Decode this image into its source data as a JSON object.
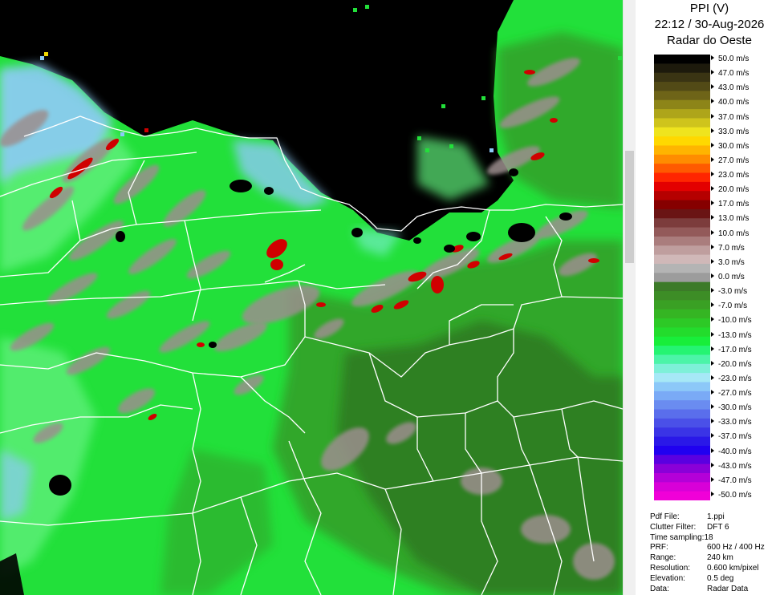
{
  "header": {
    "product": "PPI (V)",
    "datetime": "22:12 / 30-Aug-2026",
    "station": "Radar do Oeste"
  },
  "scale": {
    "labels": [
      "50.0 m/s",
      "47.0 m/s",
      "43.0 m/s",
      "40.0 m/s",
      "37.0 m/s",
      "33.0 m/s",
      "30.0 m/s",
      "27.0 m/s",
      "23.0 m/s",
      "20.0 m/s",
      "17.0 m/s",
      "13.0 m/s",
      "10.0 m/s",
      "7.0 m/s",
      "3.0 m/s",
      "0.0 m/s",
      "-3.0 m/s",
      "-7.0 m/s",
      "-10.0 m/s",
      "-13.0 m/s",
      "-17.0 m/s",
      "-20.0 m/s",
      "-23.0 m/s",
      "-27.0 m/s",
      "-30.0 m/s",
      "-33.0 m/s",
      "-37.0 m/s",
      "-40.0 m/s",
      "-43.0 m/s",
      "-47.0 m/s",
      "-50.0 m/s"
    ],
    "colors": [
      "#000000",
      "#1d1a0c",
      "#3a3413",
      "#524a16",
      "#6e6418",
      "#8d8518",
      "#aea51a",
      "#cfc41c",
      "#efe41e",
      "#ffd800",
      "#ffb400",
      "#ff8c00",
      "#ff5a00",
      "#ff2600",
      "#e30000",
      "#b50000",
      "#860000",
      "#6a1414",
      "#7c3c3c",
      "#935a5a",
      "#aa7d7d",
      "#bf9e9e",
      "#d0b8b8",
      "#b4b4b4",
      "#9c9c9c",
      "#3c7a28",
      "#3d8d26",
      "#3aa024",
      "#35b523",
      "#2dc926",
      "#23dc2c",
      "#18ee3a",
      "#25f472",
      "#4cf4a8",
      "#7ef0d8",
      "#a6e8f6",
      "#8cc8f8",
      "#7aaaf6",
      "#6a8cf0",
      "#5a6eec",
      "#4a50e8",
      "#3a34e6",
      "#2a18e8",
      "#2000f0",
      "#5a00e0",
      "#8a00d8",
      "#b400d8",
      "#d800d8",
      "#f000d8"
    ]
  },
  "info": [
    {
      "key": "Pdf File:",
      "value": "1.ppi"
    },
    {
      "key": "Clutter Filter:",
      "value": "DFT 6"
    },
    {
      "key": "Time sampling:",
      "value": "18"
    },
    {
      "key": "PRF:",
      "value": "600 Hz / 400 Hz"
    },
    {
      "key": "Range:",
      "value": "240 km"
    },
    {
      "key": "Resolution:",
      "value": "0.600 km/pixel"
    },
    {
      "key": "Elevation:",
      "value": "0.5 deg"
    },
    {
      "key": "Data:",
      "value": "Radar Data"
    }
  ],
  "map_colors": {
    "no_data": "#000000",
    "bright_green": "#22e03a",
    "light_green": "#5ef07a",
    "mid_green": "#31a42a",
    "dark_green": "#2f7e24",
    "gray": "#9c8e8e",
    "light_blue": "#8ccaf6",
    "cyan": "#80f0d8",
    "red": "#d00000",
    "border": "#ffffff"
  }
}
